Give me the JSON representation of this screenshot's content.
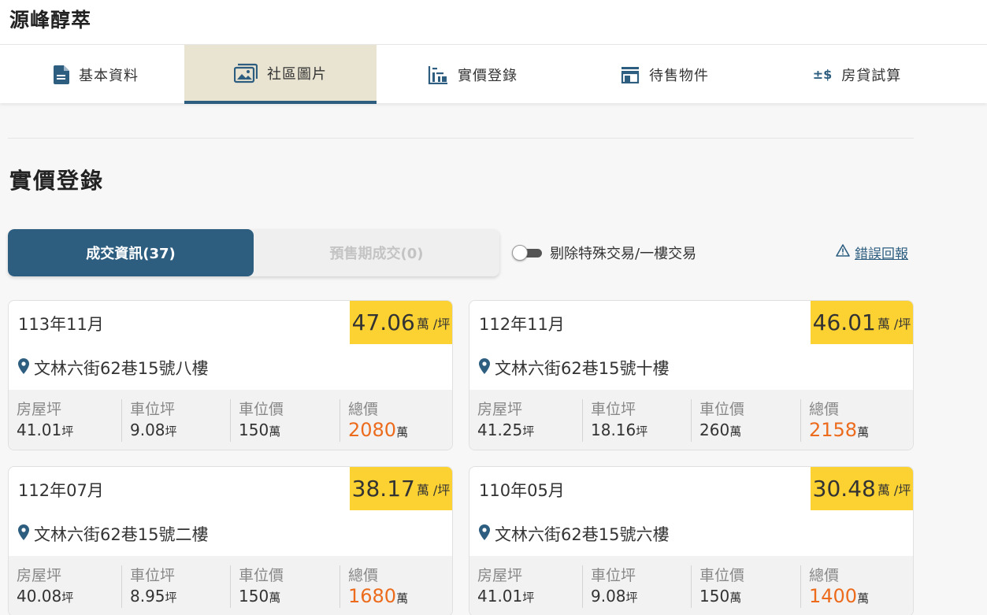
{
  "app": {
    "title": "源峰醇萃"
  },
  "tabs": [
    {
      "label": "基本資料",
      "icon": "document-icon",
      "active": false
    },
    {
      "label": "社區圖片",
      "icon": "photo-gallery-icon",
      "active": true
    },
    {
      "label": "實價登錄",
      "icon": "building-chart-icon",
      "active": false
    },
    {
      "label": "待售物件",
      "icon": "storefront-icon",
      "active": false
    },
    {
      "label": "房貸試算",
      "icon": "plus-minus-dollar-icon",
      "active": false
    }
  ],
  "section": {
    "title": "實價登錄"
  },
  "segment": {
    "deal_label": "成交資訊(37)",
    "presale_label": "預售期成交(0)"
  },
  "filter": {
    "label": "剔除特殊交易/一樓交易",
    "enabled": false
  },
  "report": {
    "label": "錯誤回報",
    "icon": "warning-triangle-icon"
  },
  "stat_labels": {
    "area": "房屋坪",
    "parking_area": "車位坪",
    "parking_price": "車位價",
    "total": "總價"
  },
  "units": {
    "ping": "坪",
    "wan": "萬",
    "per_ping": "萬 /坪"
  },
  "colors": {
    "accent": "#2d5e80",
    "badge": "#fcd232",
    "total": "#ec6b1c",
    "active_tab": "#e9e4d2"
  },
  "listings": [
    {
      "date": "113年11月",
      "unit_price": "47.06",
      "address": "文林六街62巷15號八樓",
      "area": "41.01",
      "parking_area": "9.08",
      "parking_price": "150",
      "total": "2080"
    },
    {
      "date": "112年11月",
      "unit_price": "46.01",
      "address": "文林六街62巷15號十樓",
      "area": "41.25",
      "parking_area": "18.16",
      "parking_price": "260",
      "total": "2158"
    },
    {
      "date": "112年07月",
      "unit_price": "38.17",
      "address": "文林六街62巷15號二樓",
      "area": "40.08",
      "parking_area": "8.95",
      "parking_price": "150",
      "total": "1680"
    },
    {
      "date": "110年05月",
      "unit_price": "30.48",
      "address": "文林六街62巷15號六樓",
      "area": "41.01",
      "parking_area": "9.08",
      "parking_price": "150",
      "total": "1400"
    }
  ]
}
